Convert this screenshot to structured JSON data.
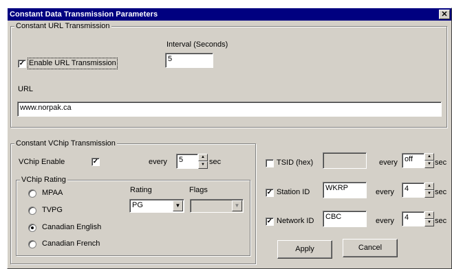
{
  "window": {
    "title": "Constant Data Transmission Parameters",
    "close_glyph": "✕"
  },
  "url_group": {
    "legend": "Constant URL Transmission",
    "enable_label": "Enable URL Transmission",
    "enable_checked": true,
    "interval_label": "Interval (Seconds)",
    "interval_value": "5",
    "url_label": "URL",
    "url_value": "www.norpak.ca"
  },
  "vchip_group": {
    "legend": "Constant VChip Transmission",
    "enable_label": "VChip Enable",
    "enable_checked": true,
    "every_label": "every",
    "every_value": "5",
    "sec_label": "sec",
    "rating_group": {
      "legend": "VChip Rating",
      "options": [
        "MPAA",
        "TVPG",
        "Canadian English",
        "Canadian French"
      ],
      "selected": "Canadian English",
      "rating_label": "Rating",
      "rating_value": "PG",
      "flags_label": "Flags",
      "flags_value": ""
    }
  },
  "right_panel": {
    "tsid": {
      "label": "TSID (hex)",
      "checked": false,
      "value": "",
      "every_label": "every",
      "every_value": "off",
      "sec_label": "sec"
    },
    "station": {
      "label": "Station ID",
      "checked": true,
      "value": "WKRP",
      "every_label": "every",
      "every_value": "4",
      "sec_label": "sec"
    },
    "network": {
      "label": "Network ID",
      "checked": true,
      "value": "CBC",
      "every_label": "every",
      "every_value": "4",
      "sec_label": "sec"
    }
  },
  "buttons": {
    "apply": "Apply",
    "cancel": "Cancel"
  },
  "icons": {
    "check": "✓",
    "arrow_up": "▲",
    "arrow_down": "▼"
  }
}
